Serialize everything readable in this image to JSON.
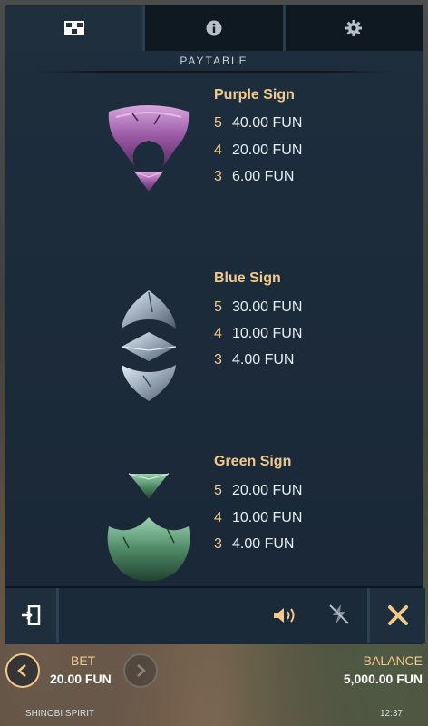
{
  "tabs": [
    {
      "name": "paytable-tab",
      "icon": "checker-icon",
      "active": true
    },
    {
      "name": "info-tab",
      "icon": "info-icon",
      "active": false
    },
    {
      "name": "settings-tab",
      "icon": "gear-icon",
      "active": false
    }
  ],
  "section_title": "PAYTABLE",
  "symbols": [
    {
      "name": "Purple Sign",
      "icon": "purple-sign-icon",
      "pays": [
        {
          "count": "5",
          "amount": "40.00 FUN"
        },
        {
          "count": "4",
          "amount": "20.00 FUN"
        },
        {
          "count": "3",
          "amount": "6.00 FUN"
        }
      ]
    },
    {
      "name": "Blue Sign",
      "icon": "blue-sign-icon",
      "pays": [
        {
          "count": "5",
          "amount": "30.00 FUN"
        },
        {
          "count": "4",
          "amount": "10.00 FUN"
        },
        {
          "count": "3",
          "amount": "4.00 FUN"
        }
      ]
    },
    {
      "name": "Green Sign",
      "icon": "green-sign-icon",
      "pays": [
        {
          "count": "5",
          "amount": "20.00 FUN"
        },
        {
          "count": "4",
          "amount": "10.00 FUN"
        },
        {
          "count": "3",
          "amount": "4.00 FUN"
        }
      ]
    }
  ],
  "bottom": {
    "bet_label": "BET",
    "bet_value": "20.00 FUN",
    "balance_label": "BALANCE",
    "balance_value": "5,000.00 FUN",
    "game_name": "SHINOBI SPIRIT",
    "clock": "12:37"
  },
  "colors": {
    "accent_gold": "#f2c98a",
    "panel_bg": "#1e2e3d",
    "close_x": "#f2c98a"
  }
}
